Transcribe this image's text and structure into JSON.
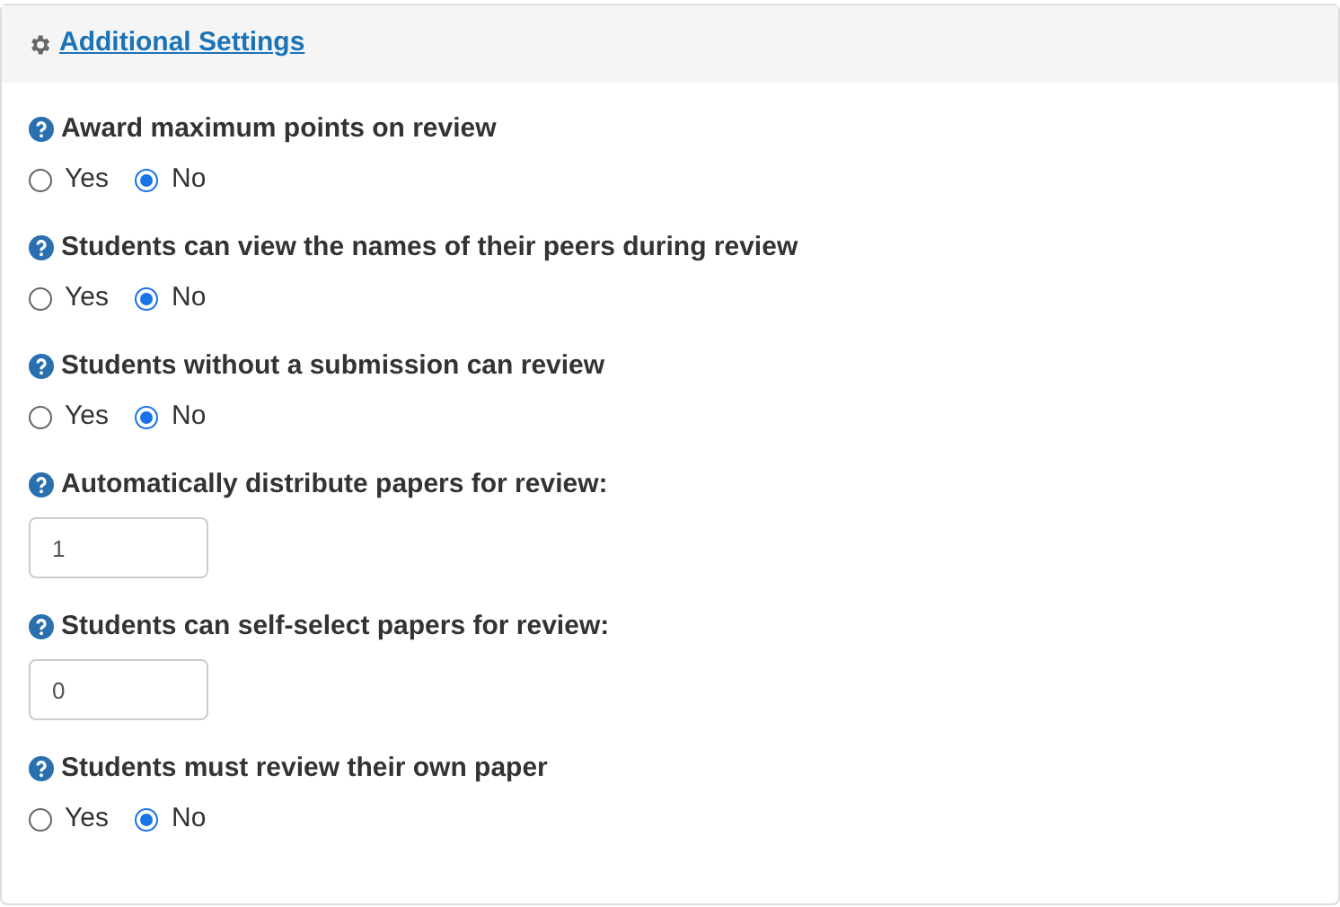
{
  "panel": {
    "title": "Additional Settings"
  },
  "settings": [
    {
      "kind": "radio",
      "label": "Award maximum points on review",
      "options": [
        {
          "label": "Yes",
          "selected": false
        },
        {
          "label": "No",
          "selected": true
        }
      ]
    },
    {
      "kind": "radio",
      "label": "Students can view the names of their peers during review",
      "options": [
        {
          "label": "Yes",
          "selected": false
        },
        {
          "label": "No",
          "selected": true
        }
      ]
    },
    {
      "kind": "radio",
      "label": "Students without a submission can review",
      "options": [
        {
          "label": "Yes",
          "selected": false
        },
        {
          "label": "No",
          "selected": true
        }
      ]
    },
    {
      "kind": "number",
      "label": "Automatically distribute papers for review:",
      "value": "1"
    },
    {
      "kind": "number",
      "label": "Students can self-select papers for review:",
      "value": "0"
    },
    {
      "kind": "radio",
      "label": "Students must review their own paper",
      "options": [
        {
          "label": "Yes",
          "selected": false
        },
        {
          "label": "No",
          "selected": true
        }
      ]
    }
  ]
}
